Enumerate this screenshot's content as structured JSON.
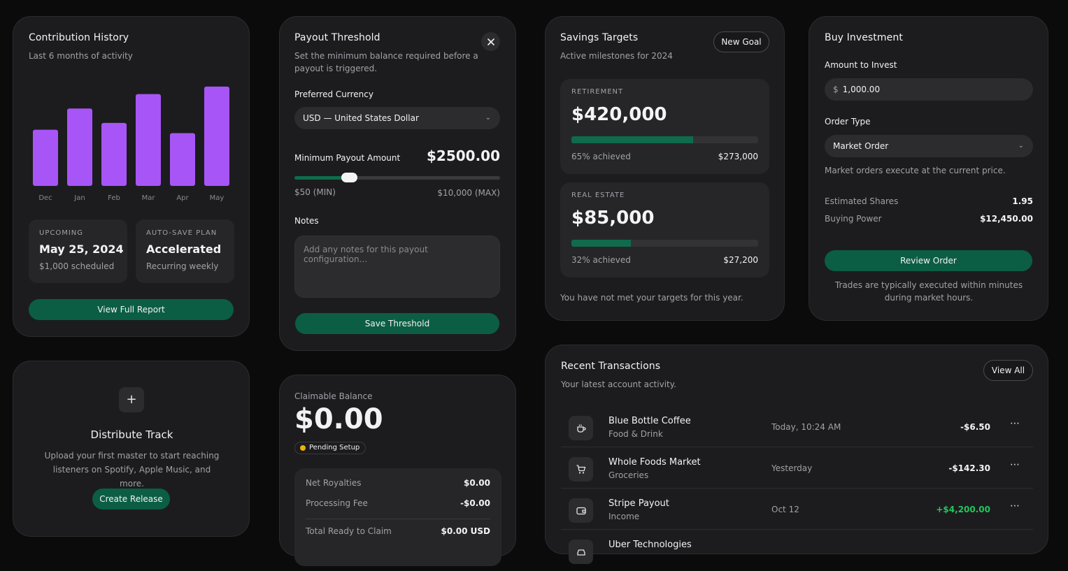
{
  "contribution": {
    "title": "Contribution History",
    "subtitle": "Last 6 months of activity",
    "upcoming_label": "UPCOMING",
    "upcoming_date": "May 25, 2024",
    "upcoming_sub": "$1,000 scheduled",
    "plan_label": "AUTO-SAVE PLAN",
    "plan_value": "Accelerated",
    "plan_sub": "Recurring weekly",
    "button": "View Full Report",
    "accent": "#a855f7"
  },
  "chart_data": {
    "type": "bar",
    "categories": [
      "Dec",
      "Jan",
      "Feb",
      "Mar",
      "Apr",
      "May"
    ],
    "values": [
      82,
      113,
      92,
      134,
      77,
      145
    ],
    "ylim": [
      0,
      150
    ],
    "grid": false,
    "title": "",
    "xlabel": "",
    "ylabel": ""
  },
  "payout": {
    "title": "Payout Threshold",
    "subtitle": "Set the minimum balance required before a payout is triggered.",
    "currency_label": "Preferred Currency",
    "currency_value": "USD — United States Dollar",
    "min_label": "Minimum Payout Amount",
    "min_value": "$2500.00",
    "slider_fraction": 0.265,
    "min_range": "$50 (MIN)",
    "max_range": "$10,000 (MAX)",
    "notes_label": "Notes",
    "notes_placeholder": "Add any notes for this payout configuration...",
    "button": "Save Threshold"
  },
  "savings": {
    "title": "Savings Targets",
    "subtitle": "Active milestones for 2024",
    "new_goal": "New Goal",
    "goals": [
      {
        "label": "RETIREMENT",
        "amount": "$420,000",
        "progress": 0.65,
        "pct_text": "65% achieved",
        "current": "$273,000"
      },
      {
        "label": "REAL ESTATE",
        "amount": "$85,000",
        "progress": 0.32,
        "pct_text": "32% achieved",
        "current": "$27,200"
      }
    ],
    "footer": "You have not met your targets for this year."
  },
  "invest": {
    "title": "Buy Investment",
    "amount_label": "Amount to Invest",
    "currency_symbol": "$",
    "amount_value": "1,000.00",
    "order_label": "Order Type",
    "order_value": "Market Order",
    "order_hint": "Market orders execute at the current price.",
    "shares_label": "Estimated Shares",
    "shares_value": "1.95",
    "power_label": "Buying Power",
    "power_value": "$12,450.00",
    "button": "Review Order",
    "footnote": "Trades are typically executed within minutes during market hours."
  },
  "distribute": {
    "title": "Distribute Track",
    "description": "Upload your first master to start reaching listeners on Spotify, Apple Music, and more.",
    "button": "Create Release"
  },
  "claim": {
    "label": "Claimable Balance",
    "amount": "$0.00",
    "badge": "Pending Setup",
    "rows": [
      {
        "k": "Net Royalties",
        "v": "$0.00"
      },
      {
        "k": "Processing Fee",
        "v": "-$0.00"
      }
    ],
    "total_label": "Total Ready to Claim",
    "total_value": "$0.00 USD"
  },
  "transactions": {
    "title": "Recent Transactions",
    "subtitle": "Your latest account activity.",
    "view_all": "View All",
    "items": [
      {
        "icon": "coffee-icon",
        "name": "Blue Bottle Coffee",
        "category": "Food & Drink",
        "when": "Today, 10:24 AM",
        "amount": "-$6.50",
        "positive": false
      },
      {
        "icon": "cart-icon",
        "name": "Whole Foods Market",
        "category": "Groceries",
        "when": "Yesterday",
        "amount": "-$142.30",
        "positive": false
      },
      {
        "icon": "wallet-icon",
        "name": "Stripe Payout",
        "category": "Income",
        "when": "Oct 12",
        "amount": "+$4,200.00",
        "positive": true
      },
      {
        "icon": "car-icon",
        "name": "Uber Technologies",
        "category": "",
        "when": "",
        "amount": "",
        "positive": false
      }
    ]
  }
}
